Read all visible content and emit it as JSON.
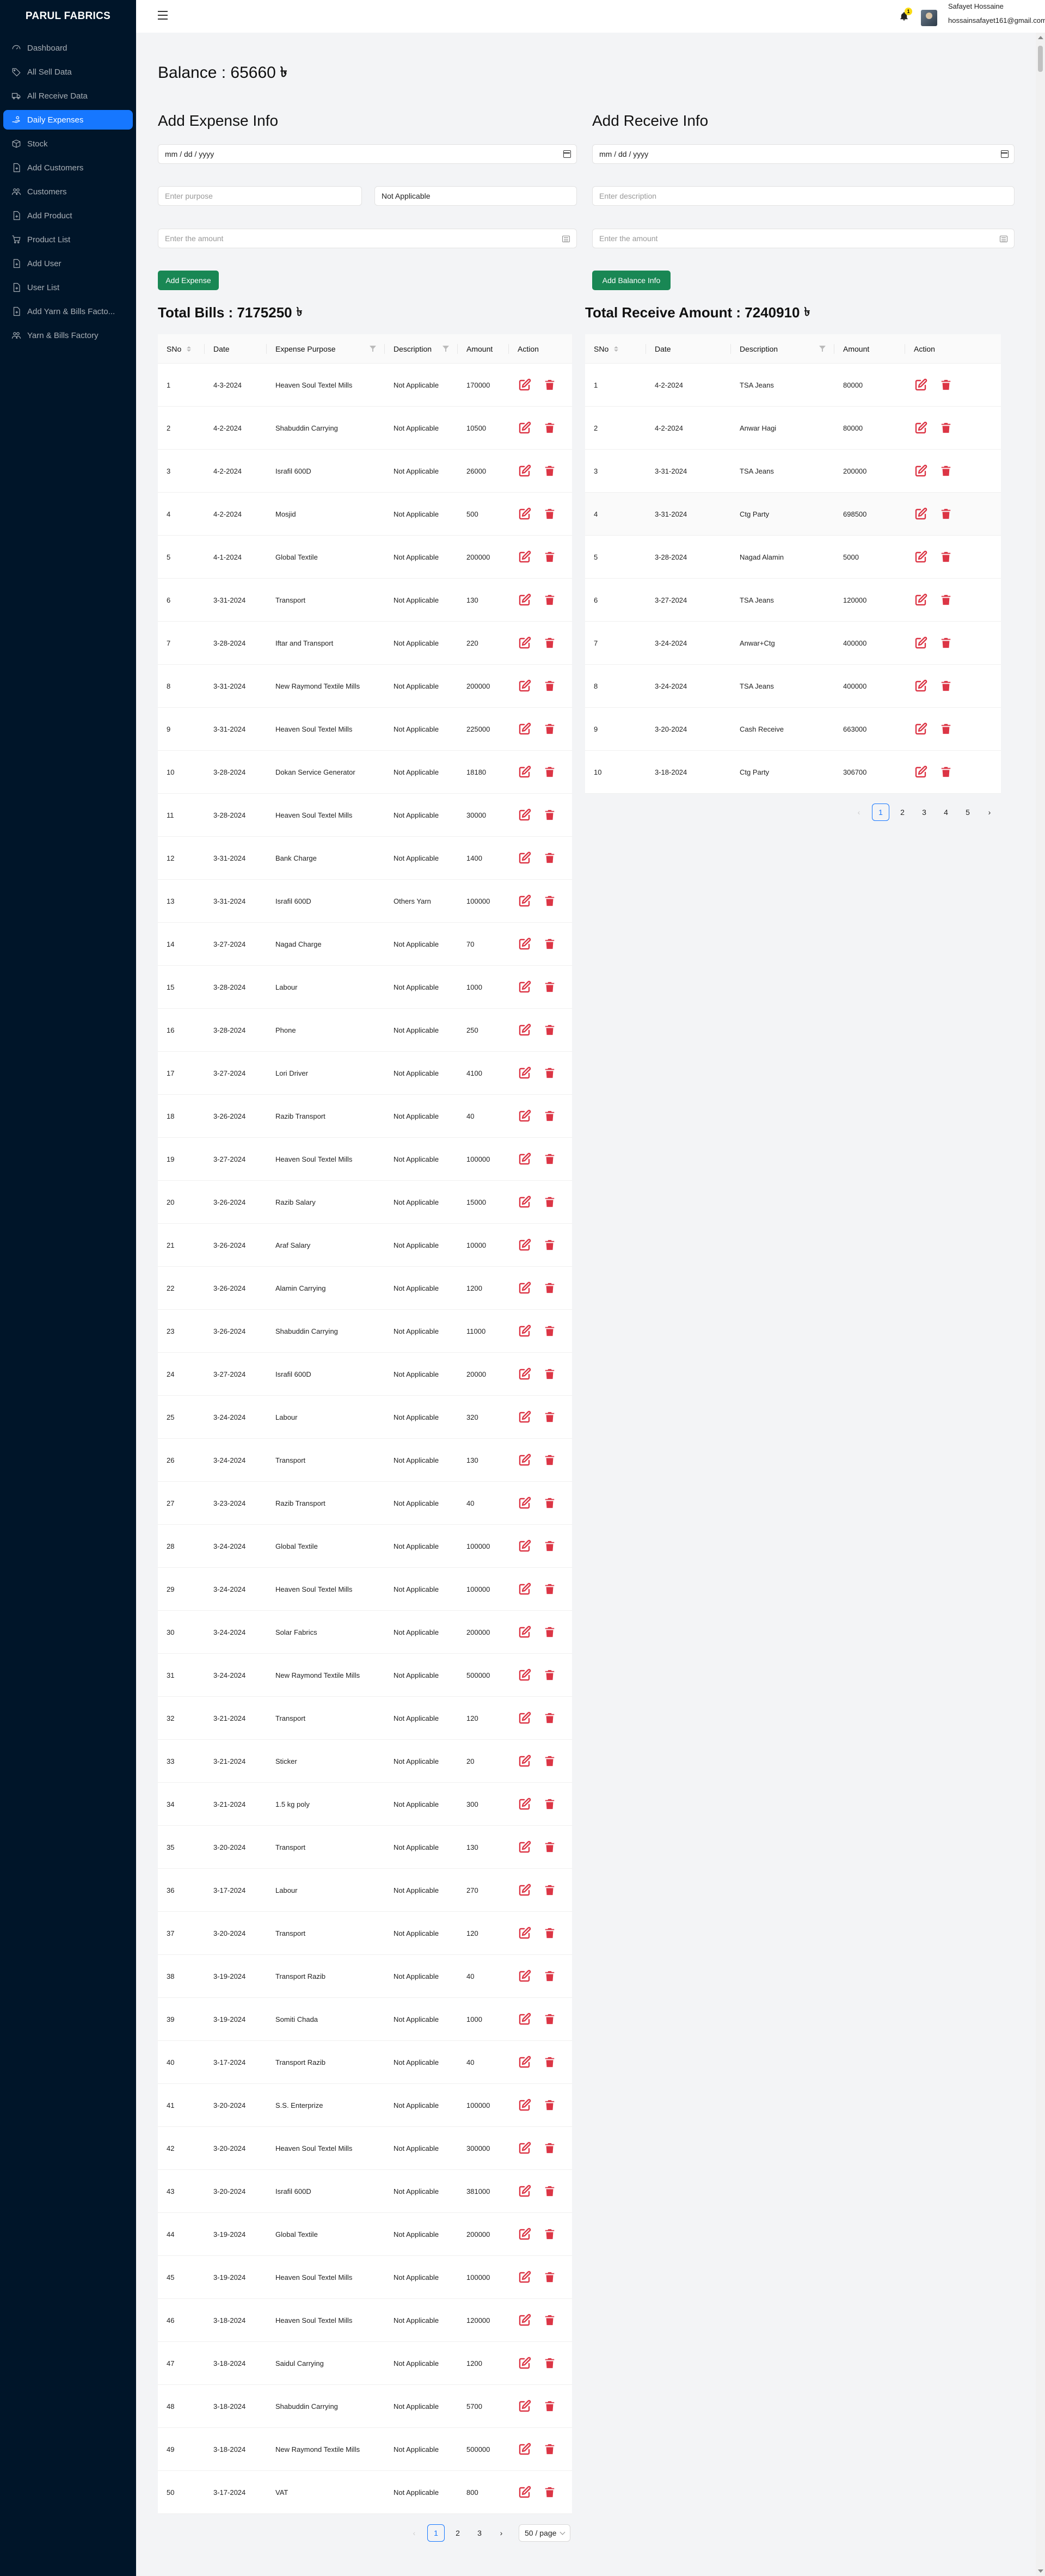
{
  "app": {
    "brand": "PARUL FABRICS"
  },
  "sidebar": {
    "items": [
      {
        "label": "Dashboard",
        "icon": "dashboard-icon",
        "active": false
      },
      {
        "label": "All Sell Data",
        "icon": "tag-icon",
        "active": false
      },
      {
        "label": "All Receive Data",
        "icon": "truck-icon",
        "active": false
      },
      {
        "label": "Daily Expenses",
        "icon": "hand-coin-icon",
        "active": true
      },
      {
        "label": "Stock",
        "icon": "box-icon",
        "active": false
      },
      {
        "label": "Add Customers",
        "icon": "file-plus-icon",
        "active": false
      },
      {
        "label": "Customers",
        "icon": "users-icon",
        "active": false
      },
      {
        "label": "Add Product",
        "icon": "file-plus-icon",
        "active": false
      },
      {
        "label": "Product List",
        "icon": "cart-icon",
        "active": false
      },
      {
        "label": "Add User",
        "icon": "file-plus-icon",
        "active": false
      },
      {
        "label": "User List",
        "icon": "file-plus-icon",
        "active": false
      },
      {
        "label": "Add Yarn & Bills Facto...",
        "icon": "file-plus-icon",
        "active": false
      },
      {
        "label": "Yarn & Bills Factory",
        "icon": "users-icon",
        "active": false
      }
    ]
  },
  "header": {
    "notification_count": "1",
    "user_name": "Safayet Hossaine",
    "user_email": "hossainsafayet161@gmail.com"
  },
  "balance": {
    "text": "Balance : 65660",
    "currency": "৳"
  },
  "expense_form": {
    "title": "Add Expense Info",
    "date_placeholder": "mm / dd / yyyy",
    "purpose_placeholder": "Enter purpose",
    "description_value": "Not Applicable",
    "amount_placeholder": "Enter the amount",
    "submit_label": "Add Expense"
  },
  "receive_form": {
    "title": "Add Receive Info",
    "date_placeholder": "mm / dd / yyyy",
    "description_placeholder": "Enter description",
    "amount_placeholder": "Enter the amount",
    "submit_label": "Add Balance Info"
  },
  "bills": {
    "title": "Total Bills : 7175250",
    "columns": [
      "SNo",
      "Date",
      "Expense Purpose",
      "Description",
      "Amount",
      "Action"
    ],
    "rows": [
      [
        "1",
        "4-3-2024",
        "Heaven Soul Textel Mills",
        "Not Applicable",
        "170000"
      ],
      [
        "2",
        "4-2-2024",
        "Shabuddin Carrying",
        "Not Applicable",
        "10500"
      ],
      [
        "3",
        "4-2-2024",
        "Israfil 600D",
        "Not Applicable",
        "26000"
      ],
      [
        "4",
        "4-2-2024",
        "Mosjid",
        "Not Applicable",
        "500"
      ],
      [
        "5",
        "4-1-2024",
        "Global Textile",
        "Not Applicable",
        "200000"
      ],
      [
        "6",
        "3-31-2024",
        "Transport",
        "Not Applicable",
        "130"
      ],
      [
        "7",
        "3-28-2024",
        "Iftar and Transport",
        "Not Applicable",
        "220"
      ],
      [
        "8",
        "3-31-2024",
        "New Raymond Textile Mills",
        "Not Applicable",
        "200000"
      ],
      [
        "9",
        "3-31-2024",
        "Heaven Soul Textel Mills",
        "Not Applicable",
        "225000"
      ],
      [
        "10",
        "3-28-2024",
        "Dokan Service Generator",
        "Not Applicable",
        "18180"
      ],
      [
        "11",
        "3-28-2024",
        "Heaven Soul Textel Mills",
        "Not Applicable",
        "30000"
      ],
      [
        "12",
        "3-31-2024",
        "Bank Charge",
        "Not Applicable",
        "1400"
      ],
      [
        "13",
        "3-31-2024",
        "Israfil 600D",
        "Others Yarn",
        "100000"
      ],
      [
        "14",
        "3-27-2024",
        "Nagad Charge",
        "Not Applicable",
        "70"
      ],
      [
        "15",
        "3-28-2024",
        "Labour",
        "Not Applicable",
        "1000"
      ],
      [
        "16",
        "3-28-2024",
        "Phone",
        "Not Applicable",
        "250"
      ],
      [
        "17",
        "3-27-2024",
        "Lori Driver",
        "Not Applicable",
        "4100"
      ],
      [
        "18",
        "3-26-2024",
        "Razib Transport",
        "Not Applicable",
        "40"
      ],
      [
        "19",
        "3-27-2024",
        "Heaven Soul Textel Mills",
        "Not Applicable",
        "100000"
      ],
      [
        "20",
        "3-26-2024",
        "Razib Salary",
        "Not Applicable",
        "15000"
      ],
      [
        "21",
        "3-26-2024",
        "Araf Salary",
        "Not Applicable",
        "10000"
      ],
      [
        "22",
        "3-26-2024",
        "Alamin Carrying",
        "Not Applicable",
        "1200"
      ],
      [
        "23",
        "3-26-2024",
        "Shabuddin Carrying",
        "Not Applicable",
        "11000"
      ],
      [
        "24",
        "3-27-2024",
        "Israfil 600D",
        "Not Applicable",
        "20000"
      ],
      [
        "25",
        "3-24-2024",
        "Labour",
        "Not Applicable",
        "320"
      ],
      [
        "26",
        "3-24-2024",
        "Transport",
        "Not Applicable",
        "130"
      ],
      [
        "27",
        "3-23-2024",
        "Razib Transport",
        "Not Applicable",
        "40"
      ],
      [
        "28",
        "3-24-2024",
        "Global Textile",
        "Not Applicable",
        "100000"
      ],
      [
        "29",
        "3-24-2024",
        "Heaven Soul Textel Mills",
        "Not Applicable",
        "100000"
      ],
      [
        "30",
        "3-24-2024",
        "Solar Fabrics",
        "Not Applicable",
        "200000"
      ],
      [
        "31",
        "3-24-2024",
        "New Raymond Textile Mills",
        "Not Applicable",
        "500000"
      ],
      [
        "32",
        "3-21-2024",
        "Transport",
        "Not Applicable",
        "120"
      ],
      [
        "33",
        "3-21-2024",
        "Sticker",
        "Not Applicable",
        "20"
      ],
      [
        "34",
        "3-21-2024",
        "1.5 kg poly",
        "Not Applicable",
        "300"
      ],
      [
        "35",
        "3-20-2024",
        "Transport",
        "Not Applicable",
        "130"
      ],
      [
        "36",
        "3-17-2024",
        "Labour",
        "Not Applicable",
        "270"
      ],
      [
        "37",
        "3-20-2024",
        "Transport",
        "Not Applicable",
        "120"
      ],
      [
        "38",
        "3-19-2024",
        "Transport Razib",
        "Not Applicable",
        "40"
      ],
      [
        "39",
        "3-19-2024",
        "Somiti Chada",
        "Not Applicable",
        "1000"
      ],
      [
        "40",
        "3-17-2024",
        "Transport Razib",
        "Not Applicable",
        "40"
      ],
      [
        "41",
        "3-20-2024",
        "S.S. Enterprize",
        "Not Applicable",
        "100000"
      ],
      [
        "42",
        "3-20-2024",
        "Heaven Soul Textel Mills",
        "Not Applicable",
        "300000"
      ],
      [
        "43",
        "3-20-2024",
        "Israfil 600D",
        "Not Applicable",
        "381000"
      ],
      [
        "44",
        "3-19-2024",
        "Global Textile",
        "Not Applicable",
        "200000"
      ],
      [
        "45",
        "3-19-2024",
        "Heaven Soul Textel Mills",
        "Not Applicable",
        "100000"
      ],
      [
        "46",
        "3-18-2024",
        "Heaven Soul Textel Mills",
        "Not Applicable",
        "120000"
      ],
      [
        "47",
        "3-18-2024",
        "Saidul Carrying",
        "Not Applicable",
        "1200"
      ],
      [
        "48",
        "3-18-2024",
        "Shabuddin Carrying",
        "Not Applicable",
        "5700"
      ],
      [
        "49",
        "3-18-2024",
        "New Raymond Textile Mills",
        "Not Applicable",
        "500000"
      ],
      [
        "50",
        "3-17-2024",
        "VAT",
        "Not Applicable",
        "800"
      ]
    ],
    "pagination": {
      "pages": [
        "1",
        "2",
        "3"
      ],
      "current": "1",
      "page_size": "50 / page"
    }
  },
  "receives": {
    "title": "Total Receive Amount : 7240910",
    "columns": [
      "SNo",
      "Date",
      "Description",
      "Amount",
      "Action"
    ],
    "rows": [
      [
        "1",
        "4-2-2024",
        "TSA Jeans",
        "80000"
      ],
      [
        "2",
        "4-2-2024",
        "Anwar Hagi",
        "80000"
      ],
      [
        "3",
        "3-31-2024",
        "TSA Jeans",
        "200000"
      ],
      [
        "4",
        "3-31-2024",
        "Ctg Party",
        "698500"
      ],
      [
        "5",
        "3-28-2024",
        "Nagad Alamin",
        "5000"
      ],
      [
        "6",
        "3-27-2024",
        "TSA Jeans",
        "120000"
      ],
      [
        "7",
        "3-24-2024",
        "Anwar+Ctg",
        "400000"
      ],
      [
        "8",
        "3-24-2024",
        "TSA Jeans",
        "400000"
      ],
      [
        "9",
        "3-20-2024",
        "Cash Receive",
        "663000"
      ],
      [
        "10",
        "3-18-2024",
        "Ctg Party",
        "306700"
      ]
    ],
    "pagination": {
      "pages": [
        "1",
        "2",
        "3",
        "4",
        "5"
      ],
      "current": "1"
    }
  },
  "colors": {
    "sidebar_bg": "#001529",
    "active_nav": "#1677ff",
    "button_green": "#198754",
    "action_red": "#dc3545"
  }
}
